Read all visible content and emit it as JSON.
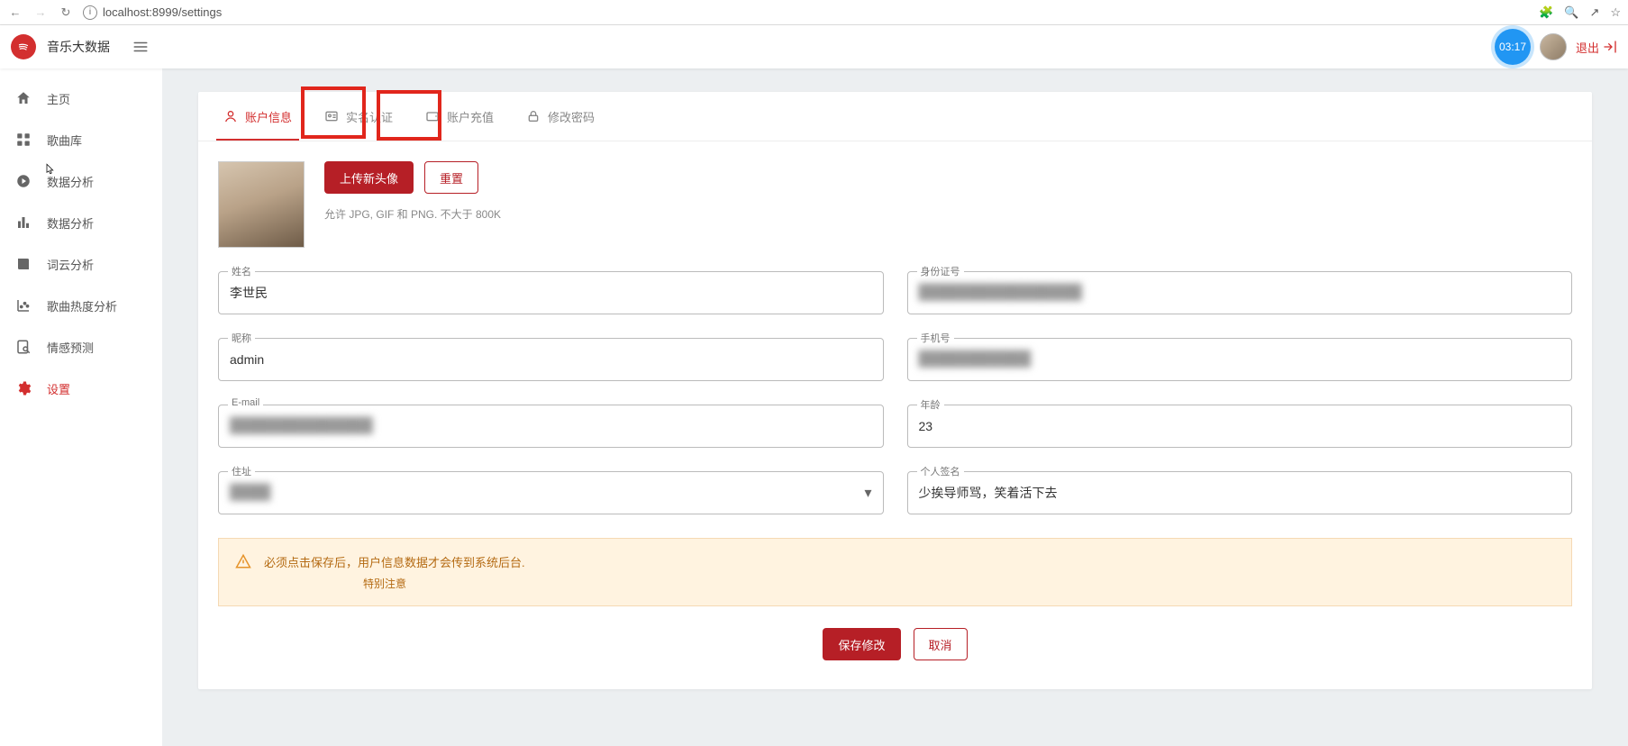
{
  "browser": {
    "url": "localhost:8999/settings"
  },
  "app": {
    "title": "音乐大数据",
    "timer": "03:17",
    "logout": "退出"
  },
  "sidebar": {
    "items": [
      {
        "label": "主页"
      },
      {
        "label": "歌曲库"
      },
      {
        "label": "数据分析"
      },
      {
        "label": "数据分析"
      },
      {
        "label": "词云分析"
      },
      {
        "label": "歌曲热度分析"
      },
      {
        "label": "情感预测"
      },
      {
        "label": "设置"
      }
    ]
  },
  "tabs": {
    "items": [
      {
        "label": "账户信息"
      },
      {
        "label": "实名认证"
      },
      {
        "label": "账户充值"
      },
      {
        "label": "修改密码"
      }
    ]
  },
  "avatar": {
    "upload": "上传新头像",
    "reset": "重置",
    "hint": "允许 JPG, GIF 和 PNG. 不大于 800K"
  },
  "fields": {
    "name": {
      "label": "姓名",
      "value": "李世民"
    },
    "idno": {
      "label": "身份证号",
      "value": "████████████████"
    },
    "nick": {
      "label": "昵称",
      "value": "admin"
    },
    "phone": {
      "label": "手机号",
      "value": "███████████"
    },
    "email": {
      "label": "E-mail",
      "value": "██████████████"
    },
    "age": {
      "label": "年龄",
      "value": "23"
    },
    "addr": {
      "label": "住址",
      "value": "████"
    },
    "sign": {
      "label": "个人签名",
      "value": "少挨导师骂，笑着活下去"
    }
  },
  "alert": {
    "line1": "必须点击保存后，用户信息数据才会传到系统后台.",
    "line2": "特别注意"
  },
  "actions": {
    "save": "保存修改",
    "cancel": "取消"
  }
}
